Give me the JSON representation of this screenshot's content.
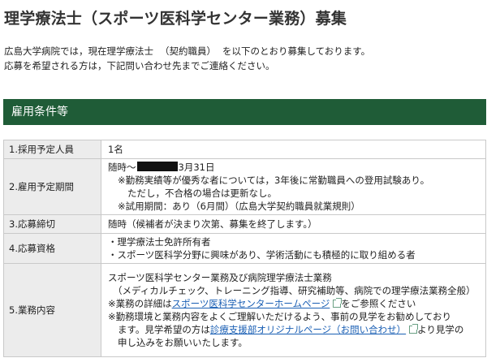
{
  "page": {
    "title": "理学療法士（スポーツ医科学センター業務）募集",
    "intro": {
      "line1_a": "広島大学病院では，現在理学療法士",
      "line1_b": "（契約職員）",
      "line1_c": "を以下のとおり募集しております。",
      "line2": "応募を希望される方は，下記問い合わせ先までご連絡ください。"
    }
  },
  "section": {
    "heading": "雇用条件等"
  },
  "rows": [
    {
      "label": "1.採用予定人員",
      "lines": [
        "1名"
      ]
    },
    {
      "label": "2.雇用予定期間",
      "line1_a": "随時～",
      "line1_b": "3月31日",
      "line2": "※勤務実績等が優秀な者については，3年後に常勤職員への登用試験あり。",
      "line3": "ただし，不合格の場合は更新なし。",
      "line4": "※試用期間：あり（6月間）（広島大学契約職員就業規則）"
    },
    {
      "label": "3.応募締切",
      "lines": [
        "随時（候補者が決まり次第、募集を終了します。）"
      ]
    },
    {
      "label": "4.応募資格",
      "lines": [
        "・理学療法士免許所有者",
        "・スポーツ医科学分野に興味があり、学術活動にも積極的に取り組める者"
      ]
    },
    {
      "label": "5.業務内容",
      "line1": "スポーツ医科学センター業務及び病院理学療法士業務",
      "line2": "（メディカルチェック、トレーニング指導、研究補助等、病院での理学療法業務全般）",
      "line3_a": "※業務の詳細は",
      "line3_link": "スポーツ医科学センターホームページ",
      "line3_b": "をご参照ください",
      "line4": "※勤務環境と業務内容をよくご理解いただけるよう、事前の見学をお勧めしており",
      "line5_a": "ます。見学希望の方は",
      "line5_link": "診療支援部オリジナルページ（お問い合わせ）",
      "line5_b": "より見学の",
      "line6": "申し込みをお願いいたします。"
    }
  ],
  "colors": {
    "section_bar": "#1f5c37",
    "label_bg": "#ececec",
    "link": "#1a5fb4",
    "redaction": "#111111"
  },
  "icons": {
    "external_link": "external-link-icon"
  }
}
